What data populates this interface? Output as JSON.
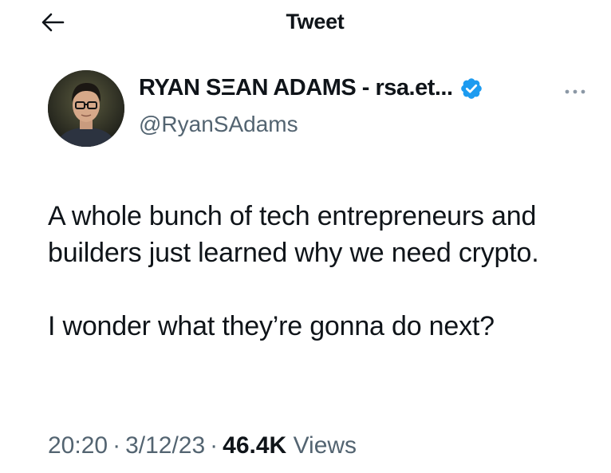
{
  "header": {
    "title": "Tweet",
    "back_icon": "arrow-left-icon"
  },
  "author": {
    "display_name": "RYAN SΞAN ADAMS - rsa.et...",
    "handle": "@RyanSAdams",
    "verified": true,
    "verified_color": "#1d9bf0",
    "avatar_icon": "user-avatar"
  },
  "more_icon": "more-horizontal-icon",
  "tweet": {
    "paragraphs": [
      "A whole bunch of tech entrepreneurs and builders just learned why we need crypto.",
      "I wonder what they’re gonna do next?"
    ]
  },
  "meta": {
    "time": "20:20",
    "date": "3/12/23",
    "separator": "·",
    "views_count": "46.4K",
    "views_label": "Views"
  },
  "colors": {
    "text_primary": "#0f1419",
    "text_secondary": "#536471",
    "accent": "#1d9bf0"
  }
}
